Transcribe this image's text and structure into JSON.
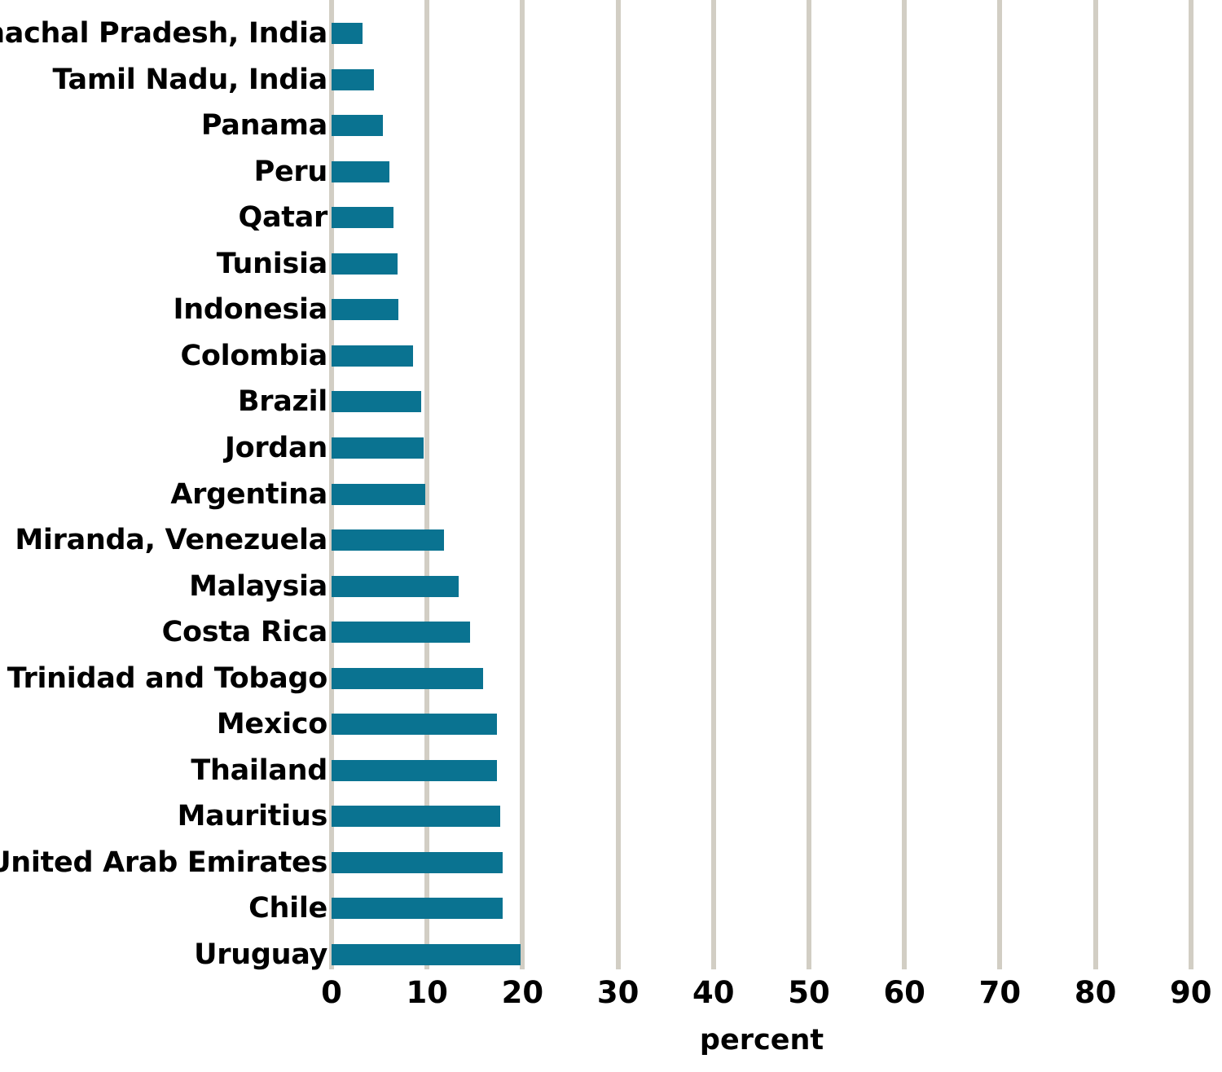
{
  "chart_data": {
    "type": "bar",
    "orientation": "horizontal",
    "title": "",
    "subtitle": "",
    "xlabel": "percent",
    "ylabel": "",
    "xlim": [
      0,
      90
    ],
    "xticks": [
      0,
      10,
      20,
      30,
      40,
      50,
      60,
      70,
      80,
      90
    ],
    "xtick_labels": [
      "0",
      "10",
      "20",
      "30",
      "40",
      "50",
      "60",
      "70",
      "80",
      "90"
    ],
    "grid": "vertical",
    "legend": "none",
    "bar_color": "#0a7391",
    "gridline_color": "#d2cec4",
    "background_color": "#ffffff",
    "categories": [
      "Himachal Pradesh, India",
      "Tamil Nadu, India",
      "Panama",
      "Peru",
      "Qatar",
      "Tunisia",
      "Indonesia",
      "Colombia",
      "Brazil",
      "Jordan",
      "Argentina",
      "Miranda, Venezuela",
      "Malaysia",
      "Costa Rica",
      "Trinidad and Tobago",
      "Mexico",
      "Thailand",
      "Mauritius",
      "United Arab Emirates",
      "Chile",
      "Uruguay"
    ],
    "values": [
      3.2,
      4.4,
      5.4,
      6.1,
      6.5,
      6.9,
      7.0,
      8.5,
      9.4,
      9.6,
      9.8,
      11.8,
      13.3,
      14.5,
      15.9,
      17.3,
      17.3,
      17.7,
      17.9,
      17.9,
      19.8
    ]
  }
}
